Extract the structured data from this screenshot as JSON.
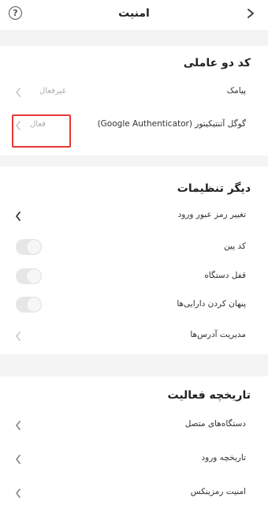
{
  "header": {
    "title": "امنیت",
    "help_glyph": "?"
  },
  "two_factor": {
    "title": "کد دو عاملی",
    "items": [
      {
        "label": "پیامک",
        "status": "غیرفعال"
      },
      {
        "label": "گوگل آتنتیکیتور (Google Authenticator)",
        "status": "فعال"
      }
    ]
  },
  "other_settings": {
    "title": "دیگر تنظیمات",
    "items": [
      {
        "label": "تغییر رمز عبور ورود"
      },
      {
        "label": "کد پین"
      },
      {
        "label": "قفل دستگاه"
      },
      {
        "label": "پنهان کردن دارایی‌ها"
      },
      {
        "label": "مدیریت آدرس‌ها"
      }
    ]
  },
  "activity": {
    "title": "تاریخچه فعالیت",
    "items": [
      {
        "label": "دستگاه‌های متصل"
      },
      {
        "label": "تاریخچه ورود"
      },
      {
        "label": "امنیت رمزینکس"
      }
    ]
  },
  "colors": {
    "background": "#f4f4f5",
    "highlight": "#e53935",
    "muted": "#aaaaaa"
  },
  "toggles": {
    "pin_code": false,
    "device_lock": false,
    "hide_assets": false
  }
}
